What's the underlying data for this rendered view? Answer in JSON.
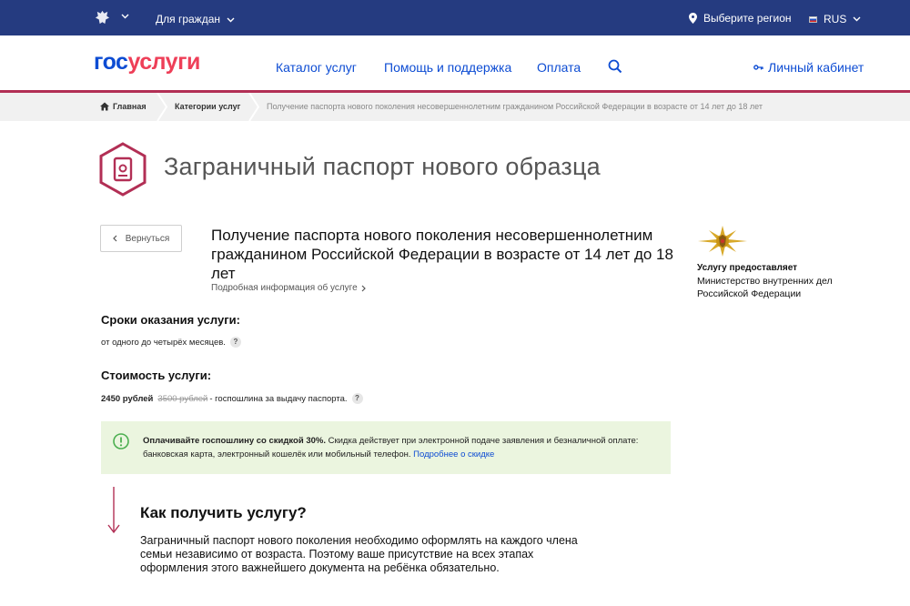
{
  "topbar": {
    "citizens_label": "Для граждан",
    "region_label": "Выберите регион",
    "lang_label": "RUS"
  },
  "header": {
    "logo_gos": "гос",
    "logo_uslugi": "услуги",
    "nav": [
      "Каталог услуг",
      "Помощь и поддержка",
      "Оплата"
    ],
    "cabinet_label": "Личный кабинет"
  },
  "breadcrumbs": {
    "home": "Главная",
    "categories": "Категории услуг",
    "current": "Получение паспорта нового поколения несовершеннолетним гражданином Российской Федерации в возрасте от 14 лет до 18 лет"
  },
  "page": {
    "title": "Заграничный паспорт нового образца",
    "back_label": "Вернуться",
    "service_title": "Получение паспорта нового поколения несовершеннолетним гражданином Российской Федерации в возрасте от 14 лет до 18 лет",
    "details_link": "Подробная информация об услуге"
  },
  "provider": {
    "label": "Услугу предоставляет",
    "name": "Министерство внутренних дел Российской Федерации"
  },
  "terms": {
    "title": "Сроки оказания услуги:",
    "text": "от одного до четырёх месяцев."
  },
  "cost": {
    "title": "Стоимость услуги:",
    "price": "2450 рублей",
    "old_price": "3500 рублей",
    "suffix": "- госпошлина за выдачу паспорта."
  },
  "promo": {
    "bold": "Оплачивайте госпошлину со скидкой 30%.",
    "text": " Скидка действует при электронной подаче заявления и безналичной оплате: банковская карта, электронный кошелёк или мобильный телефон. ",
    "link": "Подробнее о скидке"
  },
  "how": {
    "title": "Как получить услугу?",
    "text": "Заграничный паспорт нового поколения необходимо оформлять на каждого члена семьи независимо от возраста. Поэтому ваше присутствие на всех этапах оформления этого важнейшего документа на ребёнка обязательно."
  },
  "colors": {
    "topbar": "#253b80",
    "brand_blue": "#0d4cd3",
    "brand_red": "#ee3f58",
    "accent": "#b22f55",
    "promo_bg": "#ebf5df",
    "promo_icon": "#4caf50"
  },
  "icons": [
    "coat-of-arms-icon",
    "chevron-down-icon",
    "location-pin-icon",
    "flag-icon",
    "search-icon",
    "key-icon",
    "home-icon",
    "passport-icon",
    "chevron-left-icon",
    "chevron-right-icon",
    "mvd-emblem-icon",
    "info-icon",
    "arrow-down-icon"
  ]
}
